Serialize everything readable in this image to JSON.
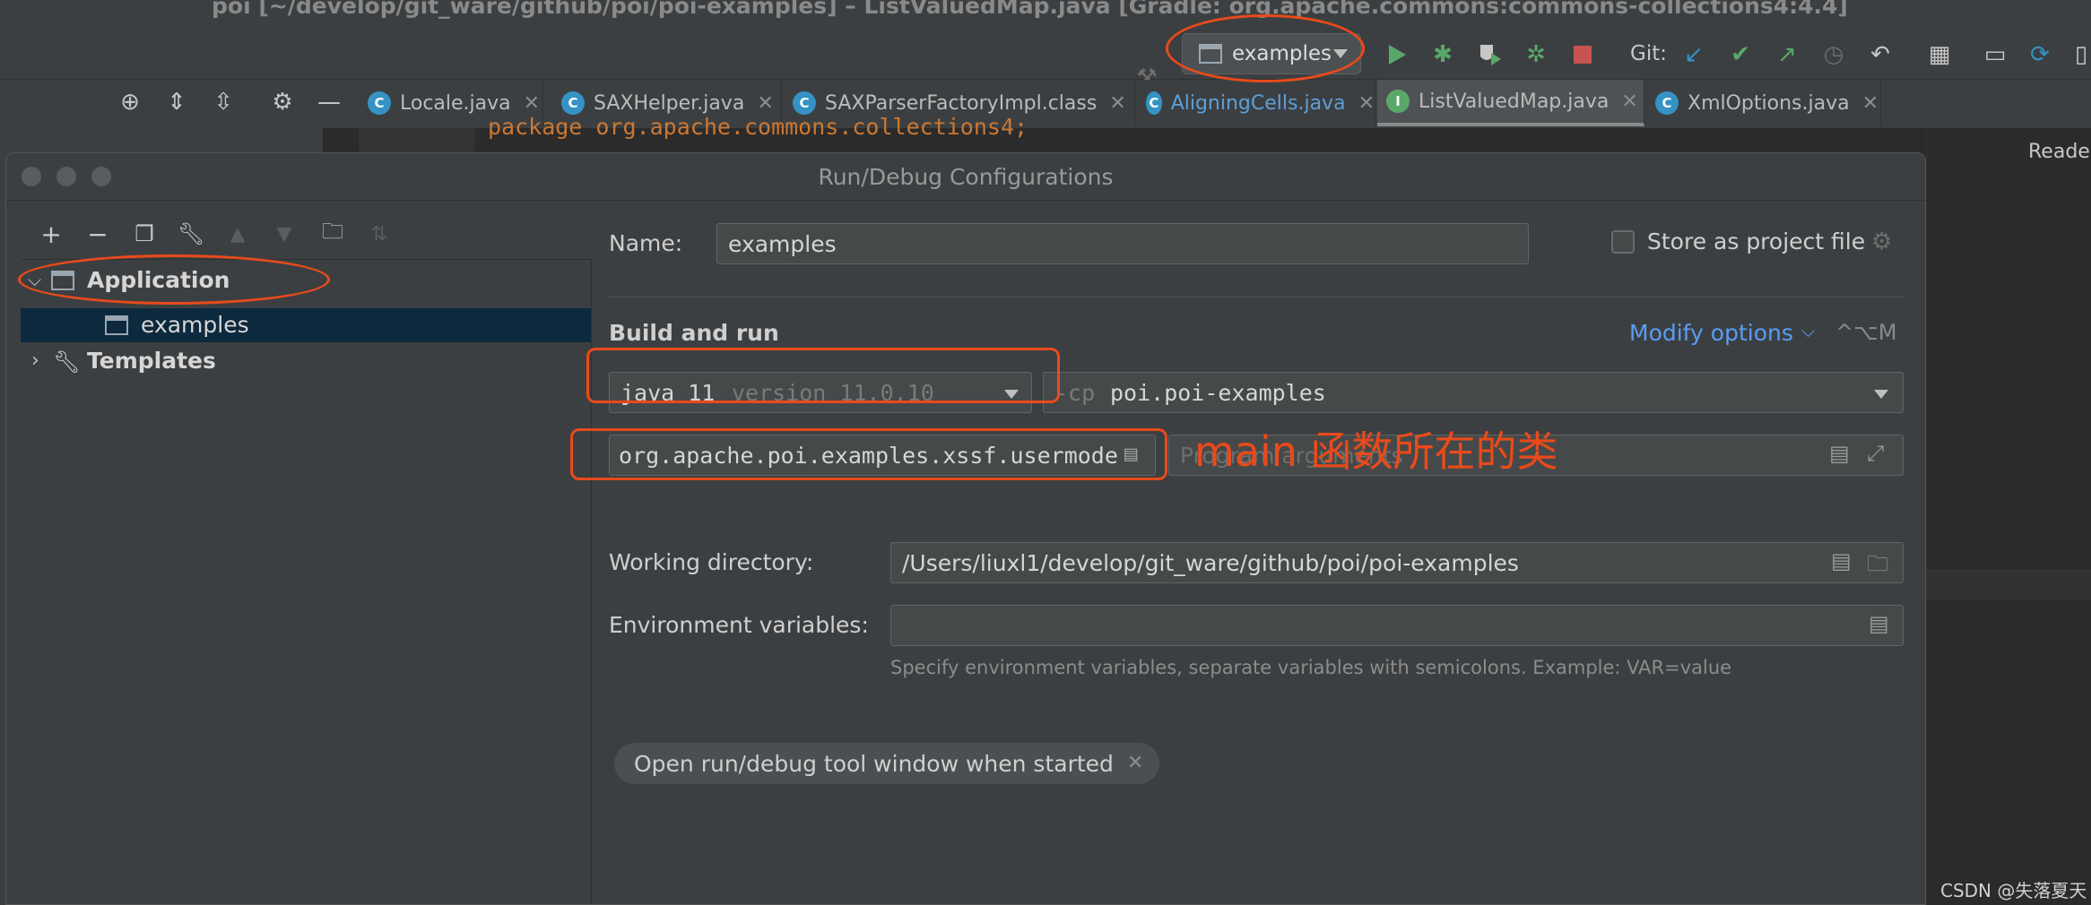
{
  "window": {
    "title": "poi [~/develop/git_ware/github/poi/poi-examples] – ListValuedMap.java [Gradle: org.apache.commons:commons-collections4:4.4]"
  },
  "toolbar": {
    "run_config": "examples",
    "git_label": "Git:"
  },
  "tabs": [
    {
      "label": "Locale.java"
    },
    {
      "label": "SAXHelper.java"
    },
    {
      "label": "SAXParserFactoryImpl.class"
    },
    {
      "label": "AligningCells.java"
    },
    {
      "label": "ListValuedMap.java"
    },
    {
      "label": "XmlOptions.java"
    }
  ],
  "editor": {
    "code_line": "package org.apache.commons.collections4;",
    "right_label": "Reader"
  },
  "dialog": {
    "title": "Run/Debug Configurations",
    "tree": {
      "application": "Application",
      "config": "examples",
      "templates": "Templates"
    },
    "name_label": "Name:",
    "name_value": "examples",
    "store_label": "Store as project file",
    "section_title": "Build and run",
    "modify_options": "Modify options",
    "modify_shortcut": "^⌥M",
    "jdk": "java 11",
    "jdk_version": "version 11.0.10",
    "cp_flag": "-cp",
    "cp_value": "poi.poi-examples",
    "main_class": "org.apache.poi.examples.xssf.usermodel",
    "program_args_placeholder": "Program arguments",
    "workdir_label": "Working directory:",
    "workdir_value": "/Users/liuxl1/develop/git_ware/github/poi/poi-examples",
    "env_label": "Environment variables:",
    "env_hint": "Specify environment variables, separate variables with semicolons. Example: VAR=value",
    "chip_label": "Open run/debug tool window when started"
  },
  "annotation": {
    "text": "main 函数所在的类",
    "color": "#ea4a1b"
  },
  "watermark": "CSDN @失落夏天"
}
